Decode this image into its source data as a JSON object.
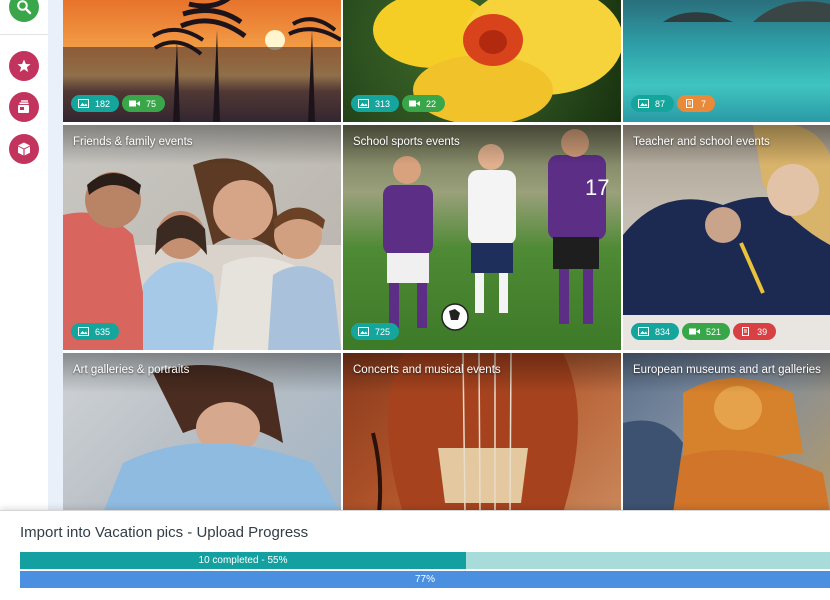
{
  "rail": {
    "buttons": [
      {
        "icon": "search-icon",
        "color": "#3aa64a"
      },
      {
        "icon": "star-icon",
        "color": "#c2335e"
      },
      {
        "icon": "cards-icon",
        "color": "#c2335e"
      },
      {
        "icon": "box-icon",
        "color": "#c2335e"
      }
    ]
  },
  "tiles": [
    {
      "title": "",
      "images": "182",
      "videos": "75"
    },
    {
      "title": "",
      "images": "313",
      "videos": "22"
    },
    {
      "title": "",
      "images": "87",
      "docs": "7"
    },
    {
      "title": "Friends & family events",
      "images": "635"
    },
    {
      "title": "School sports events",
      "images": "725"
    },
    {
      "title": "Teacher and school events",
      "images": "834",
      "videos": "521",
      "docs": "39"
    },
    {
      "title": "Art galleries & portraits"
    },
    {
      "title": "Concerts and musical events"
    },
    {
      "title": "European museums and art galleries"
    }
  ],
  "upload": {
    "title": "Import into Vacation pics - Upload Progress",
    "bar1_label": "10 completed - 55%",
    "bar1_progress": 0.55,
    "bar2_label": "77%",
    "bar2_progress": 0.77
  }
}
